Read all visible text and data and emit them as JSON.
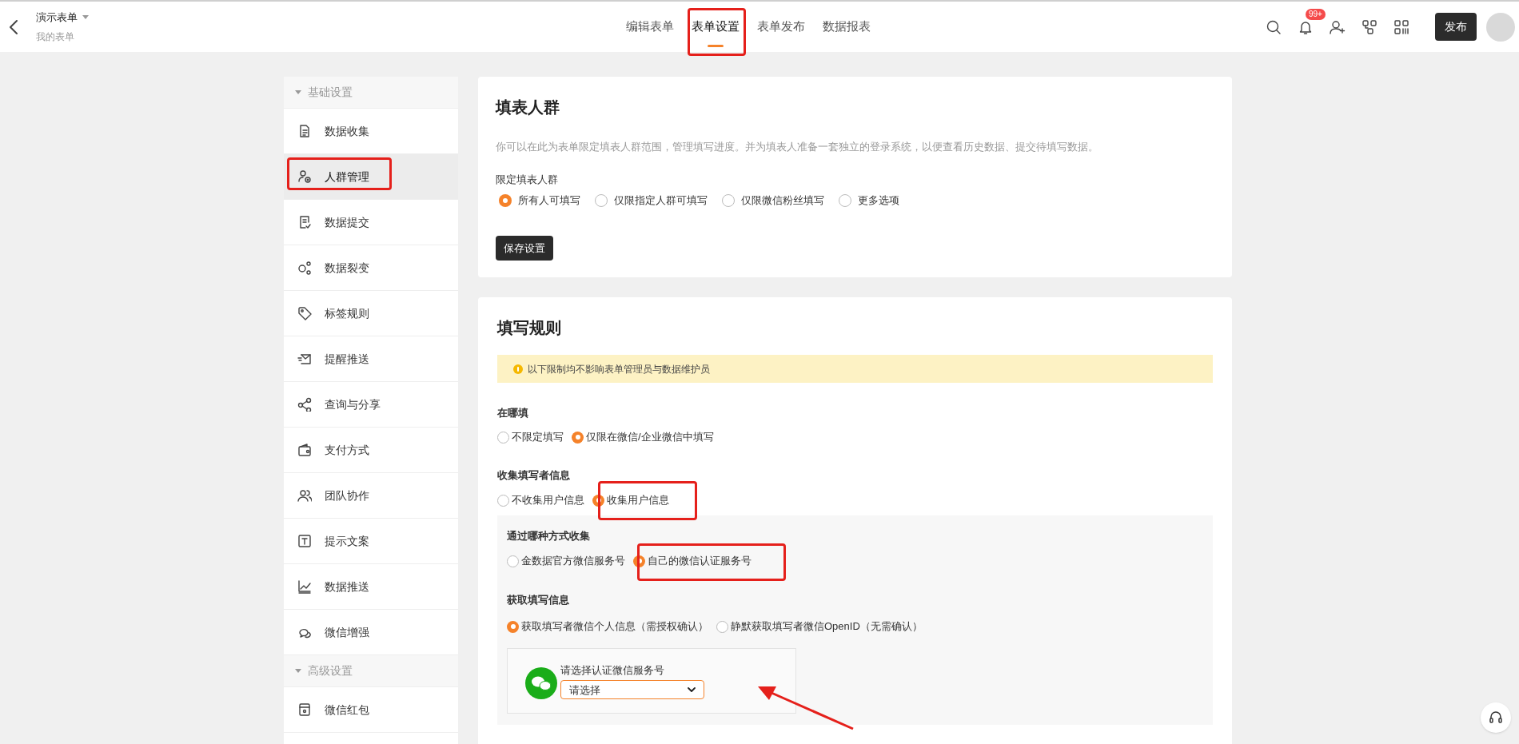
{
  "header": {
    "form_title": "演示表单",
    "breadcrumb": "我的表单",
    "tabs": [
      {
        "label": "编辑表单",
        "selected": false
      },
      {
        "label": "表单设置",
        "selected": true
      },
      {
        "label": "表单发布",
        "selected": false
      },
      {
        "label": "数据报表",
        "selected": false
      }
    ],
    "notification_badge": "99+",
    "publish_button": "发布"
  },
  "sidebar": {
    "groups": [
      {
        "title": "基础设置",
        "items": [
          {
            "label": "数据收集",
            "selected": false
          },
          {
            "label": "人群管理",
            "selected": true
          },
          {
            "label": "数据提交",
            "selected": false
          },
          {
            "label": "数据裂变",
            "selected": false
          },
          {
            "label": "标签规则",
            "selected": false
          },
          {
            "label": "提醒推送",
            "selected": false
          },
          {
            "label": "查询与分享",
            "selected": false
          },
          {
            "label": "支付方式",
            "selected": false
          },
          {
            "label": "团队协作",
            "selected": false
          },
          {
            "label": "提示文案",
            "selected": false
          },
          {
            "label": "数据推送",
            "selected": false
          },
          {
            "label": "微信增强",
            "selected": false
          }
        ]
      },
      {
        "title": "高级设置",
        "items": [
          {
            "label": "微信红包",
            "selected": false
          }
        ]
      }
    ]
  },
  "audience_card": {
    "title": "填表人群",
    "description": "你可以在此为表单限定填表人群范围，管理填写进度。并为填表人准备一套独立的登录系统，以便查看历史数据、提交待填写数据。",
    "field_label": "限定填表人群",
    "options": [
      {
        "label": "所有人可填写",
        "selected": true
      },
      {
        "label": "仅限指定人群可填写",
        "selected": false
      },
      {
        "label": "仅限微信粉丝填写",
        "selected": false
      },
      {
        "label": "更多选项",
        "selected": false
      }
    ],
    "save_button": "保存设置"
  },
  "rules_card": {
    "title": "填写规则",
    "notice": "以下限制均不影响表单管理员与数据维护员",
    "where": {
      "label": "在哪填",
      "options": [
        {
          "label": "不限定填写",
          "selected": false
        },
        {
          "label": "仅限在微信/企业微信中填写",
          "selected": true
        }
      ]
    },
    "collect": {
      "label": "收集填写者信息",
      "options": [
        {
          "label": "不收集用户信息",
          "selected": false
        },
        {
          "label": "收集用户信息",
          "selected": true
        }
      ]
    },
    "method": {
      "label": "通过哪种方式收集",
      "options": [
        {
          "label": "金数据官方微信服务号",
          "selected": false
        },
        {
          "label": "自己的微信认证服务号",
          "selected": true
        }
      ]
    },
    "fetch": {
      "label": "获取填写信息",
      "options": [
        {
          "label": "获取填写者微信个人信息（需授权确认）",
          "selected": true
        },
        {
          "label": "静默获取填写者微信OpenID（无需确认）",
          "selected": false
        }
      ]
    },
    "service_select": {
      "label": "请选择认证微信服务号",
      "value": "请选择"
    }
  }
}
